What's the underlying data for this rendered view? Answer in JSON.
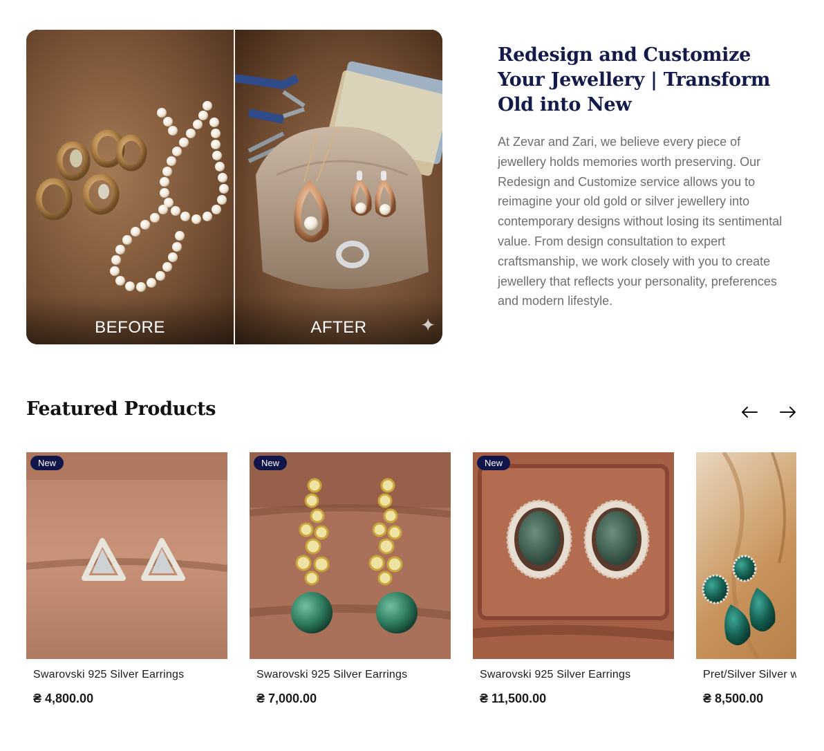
{
  "hero": {
    "before_label": "BEFORE",
    "after_label": "AFTER",
    "title": "Redesign and Customize Your Jewellery | Transform Old into New",
    "description": "At Zevar and Zari, we believe every piece of jewellery holds memories worth preserving. Our Redesign and Customize service allows you to reimagine your old gold or silver jewellery into contemporary designs without losing its sentimental value. From design consultation to expert craftsmanship, we work closely with you to create jewellery that reflects your personality, preferences and modern lifestyle."
  },
  "featured": {
    "title": "Featured Products",
    "prev_icon": "arrow-left-icon",
    "next_icon": "arrow-right-icon",
    "products": [
      {
        "badge": "New",
        "name": "Swarovski 925 Silver Earrings",
        "price": "₴ 4,800.00"
      },
      {
        "badge": "New",
        "name": "Swarovski 925 Silver Earrings",
        "price": "₴ 7,000.00"
      },
      {
        "badge": "New",
        "name": "Swarovski 925 Silver Earrings",
        "price": "₴ 11,500.00"
      },
      {
        "name": "Pret/Silver Silver woskis",
        "price": "₴ 8,500.00"
      }
    ]
  },
  "colors": {
    "heading": "#141a4a",
    "badge": "#10164a",
    "body_text": "#6e6e6e"
  }
}
